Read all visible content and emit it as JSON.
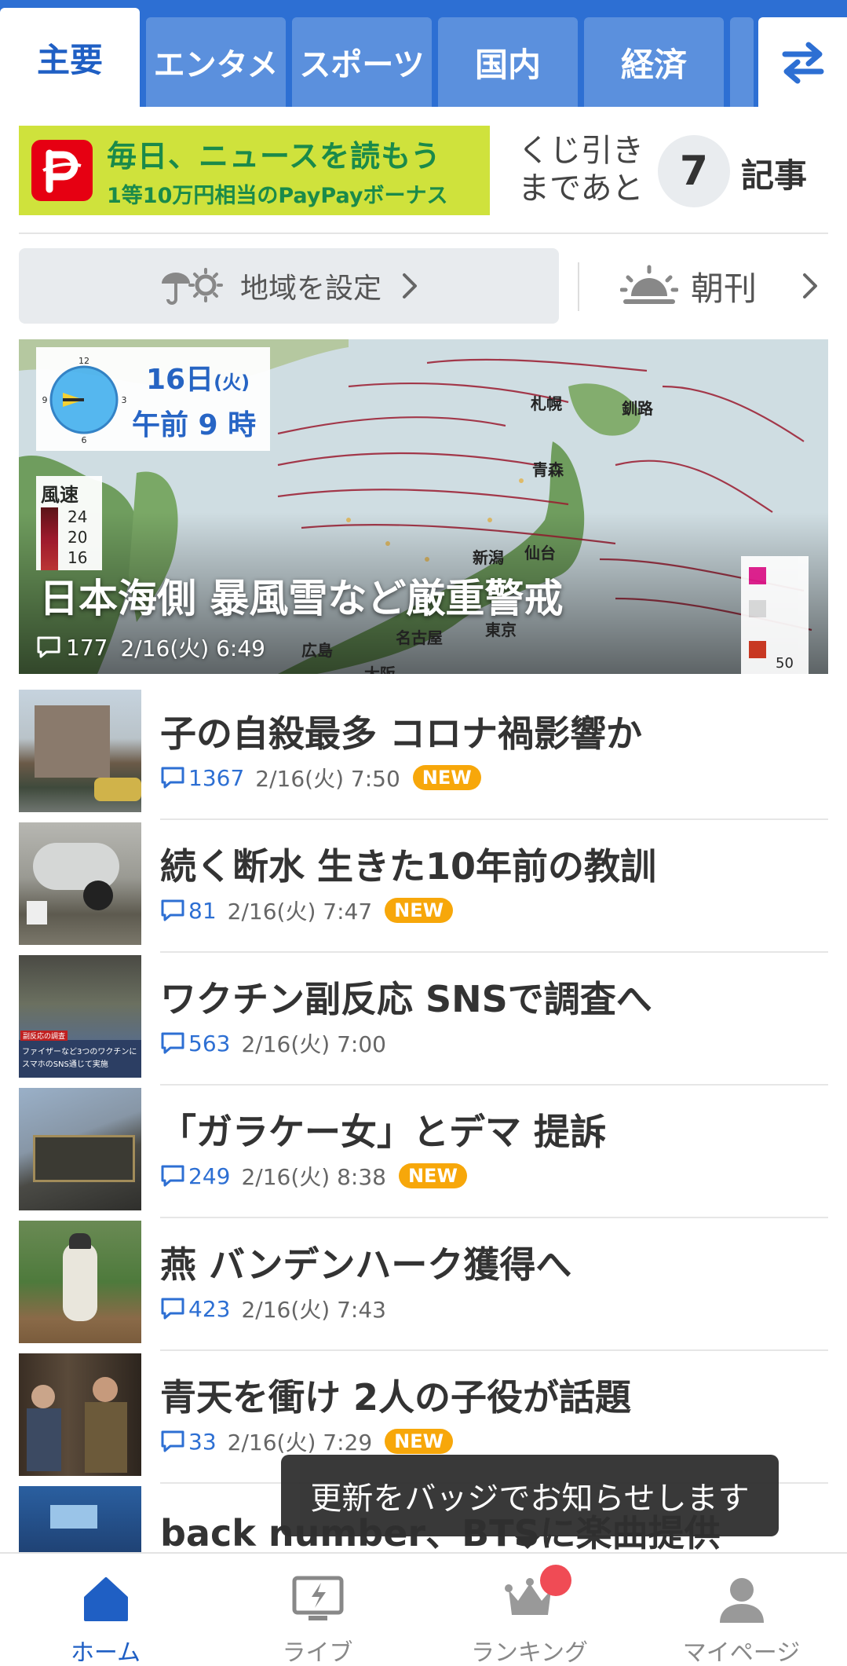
{
  "tabs": {
    "items": [
      {
        "label": "主要"
      },
      {
        "label": "エンタメ"
      },
      {
        "label": "スポーツ"
      },
      {
        "label": "国内"
      },
      {
        "label": "経済"
      }
    ],
    "switch_icon": "swap-arrows-icon"
  },
  "lottery": {
    "banner_line1": "毎日、ニュースを読もう",
    "banner_line2": "1等10万円相当のPayPayボーナス",
    "text_line1": "くじ引き",
    "text_line2": "まであと",
    "count": "7",
    "unit": "記事"
  },
  "region": {
    "label": "地域を設定"
  },
  "morning": {
    "label": "朝刊"
  },
  "hero": {
    "title": "日本海側 暴風雪など厳重警戒",
    "comments": "177",
    "time": "2/16(火) 6:49",
    "map_date": "16日",
    "map_day": "(火)",
    "map_time": "午前 9 時",
    "legend_title": "風速",
    "legend_values": [
      "24",
      "20",
      "16"
    ],
    "clock_numbers": [
      "12",
      "3",
      "6",
      "9"
    ],
    "cities": [
      "札幌",
      "釧路",
      "青森",
      "仙台",
      "新潟",
      "東京",
      "名古屋",
      "広島",
      "大阪"
    ],
    "snow_legend_value": "50"
  },
  "articles": [
    {
      "title": "子の自殺最多 コロナ禍影響か",
      "comments": "1367",
      "time": "2/16(火) 7:50",
      "badge": "NEW"
    },
    {
      "title": "続く断水 生きた10年前の教訓",
      "comments": "81",
      "time": "2/16(火) 7:47",
      "badge": "NEW"
    },
    {
      "title": "ワクチン副反応 SNSで調査へ",
      "comments": "563",
      "time": "2/16(火) 7:00",
      "badge": ""
    },
    {
      "title": "「ガラケー女」とデマ 提訴",
      "comments": "249",
      "time": "2/16(火) 8:38",
      "badge": "NEW"
    },
    {
      "title": "燕 バンデンハーク獲得へ",
      "comments": "423",
      "time": "2/16(火) 7:43",
      "badge": ""
    },
    {
      "title": "青天を衝け 2人の子役が話題",
      "comments": "33",
      "time": "2/16(火) 7:29",
      "badge": "NEW"
    },
    {
      "title": "back number、BTSに楽曲提供",
      "comments": "",
      "time": "",
      "badge": ""
    }
  ],
  "thumb_caption": {
    "line0": "副反応の調査",
    "line1": "ファイザーなど3つのワクチンに",
    "line2": "スマホのSNS通じて実施"
  },
  "tooltip": {
    "text": "更新をバッジでお知らせします"
  },
  "bottom_nav": [
    {
      "label": "ホーム",
      "icon": "home-icon"
    },
    {
      "label": "ライブ",
      "icon": "live-icon"
    },
    {
      "label": "ランキング",
      "icon": "crown-icon"
    },
    {
      "label": "マイページ",
      "icon": "person-icon"
    }
  ],
  "colors": {
    "header_blue": "#2d6fd3",
    "tab_blue": "#5b90dd",
    "new_badge": "#f7a70a",
    "comment_blue": "#2d6fd3",
    "paypay_red": "#e60012",
    "banner_green": "#cfe23c"
  }
}
